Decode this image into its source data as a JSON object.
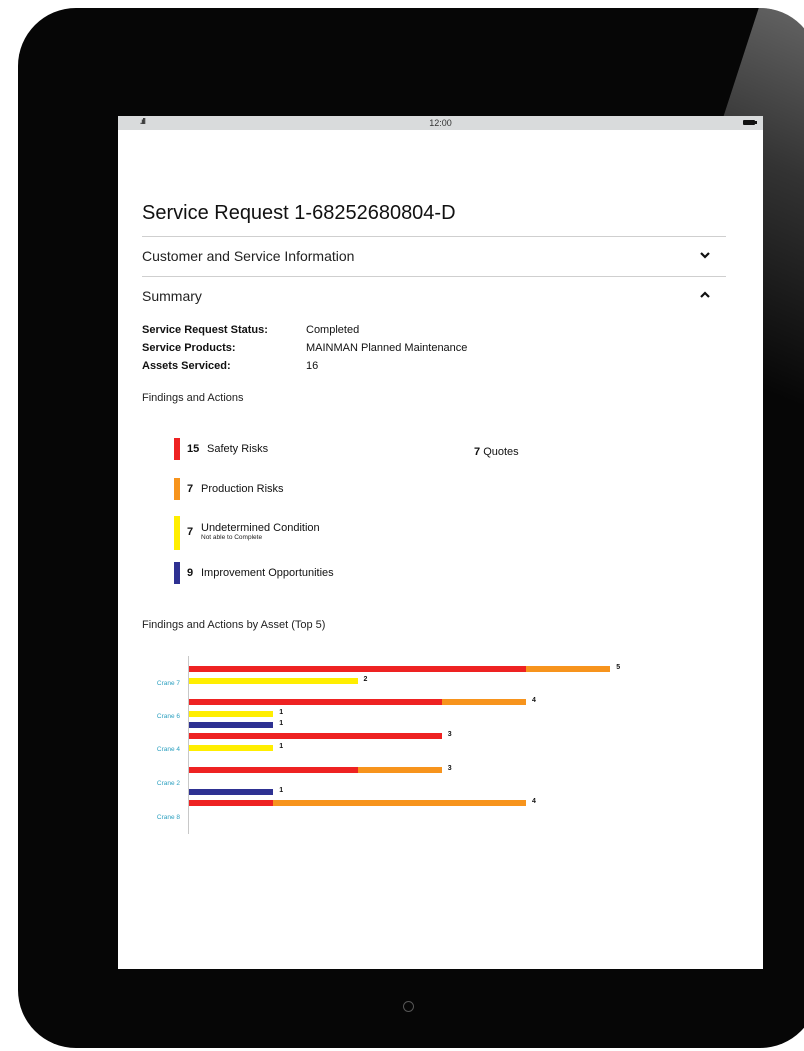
{
  "status_bar": {
    "signal": ".ıll",
    "time": "12:00",
    "battery_icon": "battery-icon"
  },
  "page": {
    "title": "Service Request 1-68252680804-D"
  },
  "sections": {
    "customer": {
      "label": "Customer and Service Information",
      "icon": "chevron-down-icon"
    },
    "summary": {
      "label": "Summary",
      "icon": "chevron-up-icon"
    }
  },
  "summary": {
    "status_label": "Service Request Status:",
    "status_value": "Completed",
    "products_label": "Service Products:",
    "products_value": "MAINMAN Planned Maintenance",
    "assets_label": "Assets Serviced:",
    "assets_value": "16"
  },
  "findings": {
    "heading": "Findings and Actions",
    "items": [
      {
        "count": "15",
        "label": "Safety Risks",
        "sublabel": "",
        "color": "#ee2222"
      },
      {
        "count": "7",
        "label": "Production Risks",
        "sublabel": "",
        "color": "#f7941d"
      },
      {
        "count": "7",
        "label": "Undetermined Condition",
        "sublabel": "Not able to Complete",
        "color": "#ffee00"
      },
      {
        "count": "9",
        "label": "Improvement Opportunities",
        "sublabel": "",
        "color": "#2e3192"
      }
    ],
    "quotes_count": "7",
    "quotes_label": "Quotes"
  },
  "chart_data": {
    "type": "bar",
    "title": "Findings and Actions by Asset (Top 5)",
    "orientation": "horizontal",
    "stacked": true,
    "categories": [
      "Crane 7",
      "Crane 6",
      "Crane 4",
      "Crane 2",
      "Crane 8"
    ],
    "colors": {
      "safety": "#ee2222",
      "production": "#f7941d",
      "undetermined": "#ffee00",
      "improvement": "#2e3192"
    },
    "rows": [
      {
        "category": "Crane 7",
        "kind": "risk",
        "segments": [
          {
            "type": "safety",
            "value": 4
          },
          {
            "type": "production",
            "value": 1
          }
        ],
        "total": 5
      },
      {
        "category": "Crane 7",
        "kind": "undetermined",
        "segments": [
          {
            "type": "undetermined",
            "value": 2
          }
        ],
        "total": 2
      },
      {
        "category": "Crane 6",
        "kind": "risk",
        "segments": [
          {
            "type": "safety",
            "value": 3
          },
          {
            "type": "production",
            "value": 1
          }
        ],
        "total": 4
      },
      {
        "category": "Crane 6",
        "kind": "undetermined",
        "segments": [
          {
            "type": "undetermined",
            "value": 1
          }
        ],
        "total": 1
      },
      {
        "category": "Crane 6",
        "kind": "improvement",
        "segments": [
          {
            "type": "improvement",
            "value": 1
          }
        ],
        "total": 1
      },
      {
        "category": "Crane 4",
        "kind": "risk",
        "segments": [
          {
            "type": "safety",
            "value": 3
          }
        ],
        "total": 3
      },
      {
        "category": "Crane 4",
        "kind": "undetermined",
        "segments": [
          {
            "type": "undetermined",
            "value": 1
          }
        ],
        "total": 1
      },
      {
        "category": "Crane 2",
        "kind": "risk",
        "segments": [
          {
            "type": "safety",
            "value": 2
          },
          {
            "type": "production",
            "value": 1
          }
        ],
        "total": 3
      },
      {
        "category": "Crane 8",
        "kind": "improvement",
        "segments": [
          {
            "type": "improvement",
            "value": 1
          }
        ],
        "total": 1
      },
      {
        "category": "Crane 8",
        "kind": "risk",
        "segments": [
          {
            "type": "safety",
            "value": 1
          },
          {
            "type": "production",
            "value": 3
          }
        ],
        "total": 4
      }
    ],
    "xlim": [
      0,
      5.4
    ],
    "grid": false,
    "legend": "none"
  }
}
